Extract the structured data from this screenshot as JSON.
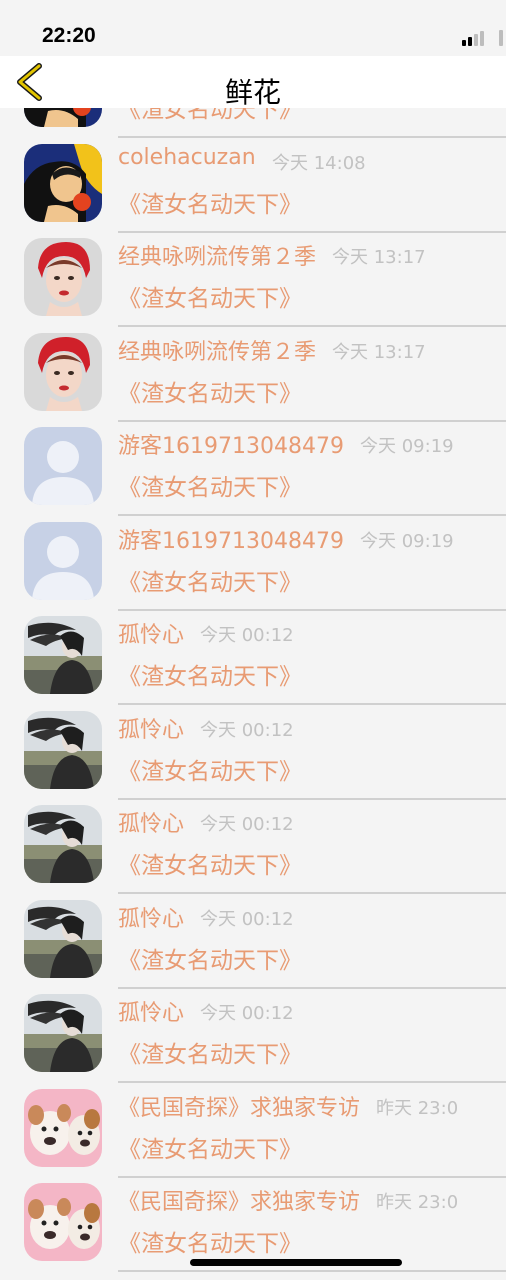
{
  "status_bar": {
    "time": "22:20"
  },
  "nav": {
    "title": "鲜花",
    "back_icon": "chevron-left-icon",
    "accent_color": "#e2c400"
  },
  "colors": {
    "name": "#e89b73",
    "time": "#c2c2c2",
    "background": "#f4f4f4"
  },
  "items": [
    {
      "name": "",
      "time": "",
      "gift": "《渣女名动天下》",
      "avatar": "yellow-portrait"
    },
    {
      "name": "colehacuzan",
      "time": "今天 14:08",
      "gift": "《渣女名动天下》",
      "avatar": "yellow-portrait"
    },
    {
      "name": "经典咏咧流传第２季",
      "time": "今天 13:17",
      "gift": "《渣女名动天下》",
      "avatar": "red-headscarf-woman"
    },
    {
      "name": "经典咏咧流传第２季",
      "time": "今天 13:17",
      "gift": "《渣女名动天下》",
      "avatar": "red-headscarf-woman"
    },
    {
      "name": "游客1619713048479",
      "time": "今天 09:19",
      "gift": "《渣女名动天下》",
      "avatar": "default-person"
    },
    {
      "name": "游客1619713048479",
      "time": "今天 09:19",
      "gift": "《渣女名动天下》",
      "avatar": "default-person"
    },
    {
      "name": "孤怜心",
      "time": "今天 00:12",
      "gift": "《渣女名动天下》",
      "avatar": "windblown-girl"
    },
    {
      "name": "孤怜心",
      "time": "今天 00:12",
      "gift": "《渣女名动天下》",
      "avatar": "windblown-girl"
    },
    {
      "name": "孤怜心",
      "time": "今天 00:12",
      "gift": "《渣女名动天下》",
      "avatar": "windblown-girl"
    },
    {
      "name": "孤怜心",
      "time": "今天 00:12",
      "gift": "《渣女名动天下》",
      "avatar": "windblown-girl"
    },
    {
      "name": "孤怜心",
      "time": "今天 00:12",
      "gift": "《渣女名动天下》",
      "avatar": "windblown-girl"
    },
    {
      "name": "《民国奇探》求独家专访",
      "time": "昨天 23:0",
      "gift": "《渣女名动天下》",
      "avatar": "pink-puppies"
    },
    {
      "name": "《民国奇探》求独家专访",
      "time": "昨天 23:0",
      "gift": "《渣女名动天下》",
      "avatar": "pink-puppies"
    }
  ]
}
